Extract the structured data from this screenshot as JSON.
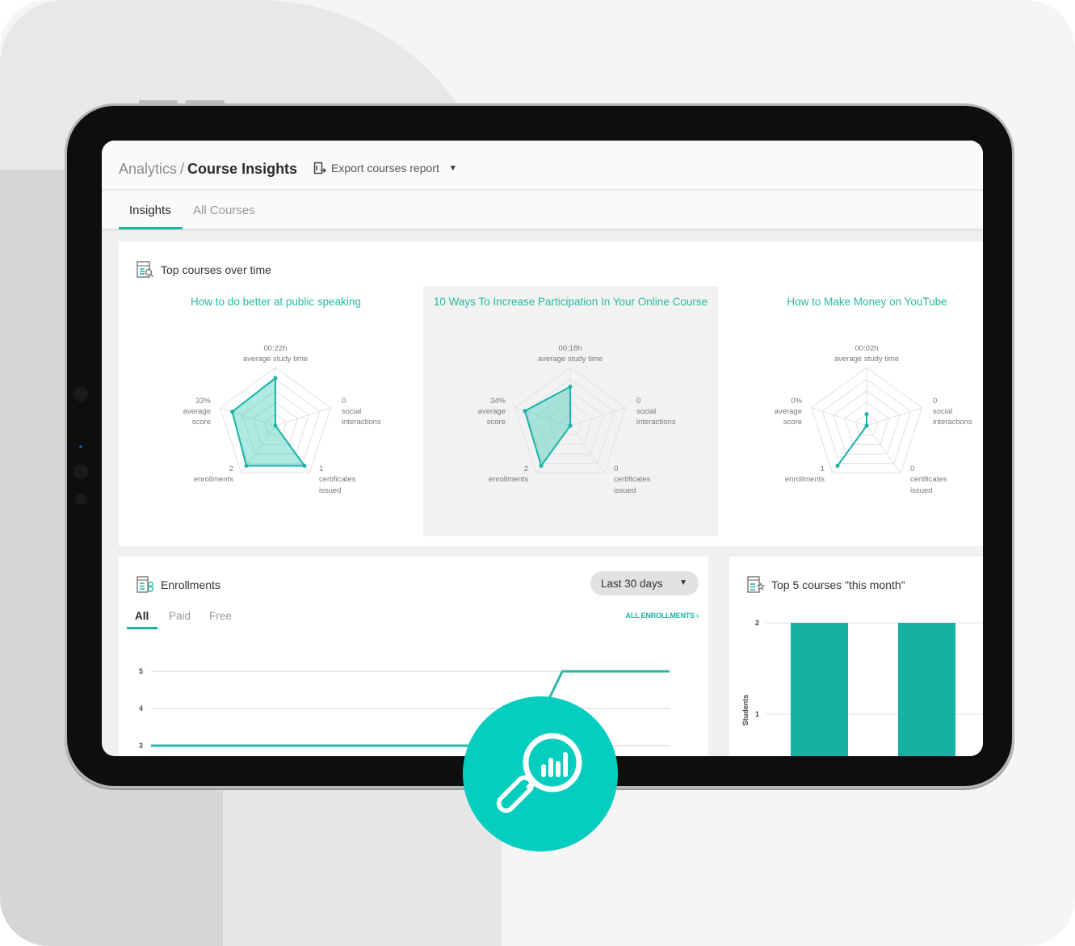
{
  "header": {
    "breadcrumb_parent": "Analytics",
    "breadcrumb_separator": "/",
    "breadcrumb_current": "Course Insights",
    "export_label": "Export courses report"
  },
  "tabs": [
    {
      "label": "Insights",
      "active": true
    },
    {
      "label": "All Courses",
      "active": false
    }
  ],
  "top_courses": {
    "title": "Top courses over time",
    "courses": [
      {
        "title": "How to do better at public speaking",
        "highlighted": false,
        "metrics": {
          "study_time": {
            "value": "00:22h",
            "label": "average study time"
          },
          "social": {
            "value": "0",
            "label1": "social",
            "label2": "interactions"
          },
          "certificates": {
            "value": "1",
            "label1": "certificates",
            "label2": "issued"
          },
          "enrollments": {
            "value": "2",
            "label": "enrollments"
          },
          "score": {
            "value": "33%",
            "label1": "average",
            "label2": "score"
          }
        },
        "normalized": [
          0.82,
          0.0,
          0.85,
          0.85,
          0.78
        ]
      },
      {
        "title": "10 Ways To Increase Participation In Your Online Course",
        "highlighted": true,
        "metrics": {
          "study_time": {
            "value": "00:18h",
            "label": "average study time"
          },
          "social": {
            "value": "0",
            "label1": "social",
            "label2": "interactions"
          },
          "certificates": {
            "value": "0",
            "label1": "certificates",
            "label2": "issued"
          },
          "enrollments": {
            "value": "2",
            "label": "enrollments"
          },
          "score": {
            "value": "34%",
            "label1": "average",
            "label2": "score"
          }
        },
        "normalized": [
          0.67,
          0.0,
          0.0,
          0.85,
          0.82
        ]
      },
      {
        "title": "How to Make Money on YouTube",
        "highlighted": false,
        "metrics": {
          "study_time": {
            "value": "00:02h",
            "label": "average study time"
          },
          "social": {
            "value": "0",
            "label1": "social",
            "label2": "interactions"
          },
          "certificates": {
            "value": "0",
            "label1": "certificates",
            "label2": "issued"
          },
          "enrollments": {
            "value": "1",
            "label": "enrollments"
          },
          "score": {
            "value": "0%",
            "label1": "average",
            "label2": "score"
          }
        },
        "normalized": [
          0.2,
          0.0,
          0.0,
          0.85,
          0.0
        ]
      }
    ]
  },
  "enrollments": {
    "title": "Enrollments",
    "date_range": "Last 30 days",
    "sub_tabs": [
      {
        "label": "All",
        "active": true
      },
      {
        "label": "Paid",
        "active": false
      },
      {
        "label": "Free",
        "active": false
      }
    ],
    "all_link": "ALL ENROLLMENTS",
    "chart": {
      "y_ticks": [
        "5",
        "4",
        "3"
      ],
      "series": [
        3,
        3,
        3,
        3,
        3,
        3,
        3,
        3,
        3,
        3,
        3,
        3,
        3,
        3,
        3,
        3,
        3,
        3,
        3,
        3,
        3,
        3,
        4,
        5,
        5,
        5,
        5,
        5,
        5,
        5
      ]
    }
  },
  "top5": {
    "title": "Top 5 courses \"this month\"",
    "y_label": "Students",
    "y_ticks": [
      "2",
      "1"
    ],
    "values": [
      2,
      2
    ]
  },
  "colors": {
    "accent": "#1ab3a6",
    "title_teal": "#2bb8a4",
    "badge": "#05cdc0"
  }
}
